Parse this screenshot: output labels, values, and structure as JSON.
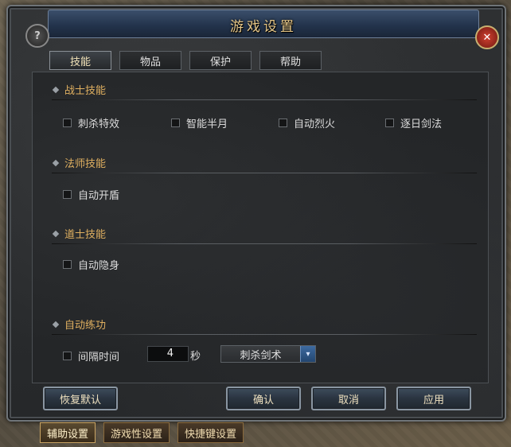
{
  "window": {
    "title": "游戏设置"
  },
  "icons": {
    "help": "?",
    "close": "✕",
    "dropdown": "▾"
  },
  "tabs": [
    {
      "label": "技能",
      "active": true
    },
    {
      "label": "物品",
      "active": false
    },
    {
      "label": "保护",
      "active": false
    },
    {
      "label": "帮助",
      "active": false
    }
  ],
  "sections": {
    "warrior": {
      "title": "战士技能",
      "options": [
        "刺杀特效",
        "智能半月",
        "自动烈火",
        "逐日剑法"
      ]
    },
    "mage": {
      "title": "法师技能",
      "options": [
        "自动开盾"
      ]
    },
    "taoist": {
      "title": "道士技能",
      "options": [
        "自动隐身"
      ]
    },
    "practice": {
      "title": "自动练功",
      "option": "间隔时间",
      "interval_value": "4",
      "unit": "秒",
      "skill_selected": "刺杀剑术"
    }
  },
  "buttons": {
    "reset": "恢复默认",
    "confirm": "确认",
    "cancel": "取消",
    "apply": "应用"
  },
  "bottom_tabs": [
    {
      "label": "辅助设置",
      "active": true
    },
    {
      "label": "游戏性设置",
      "active": false
    },
    {
      "label": "快捷键设置",
      "active": false
    }
  ],
  "colors": {
    "section_title": "#e0b060",
    "title_text": "#e8c98a"
  }
}
